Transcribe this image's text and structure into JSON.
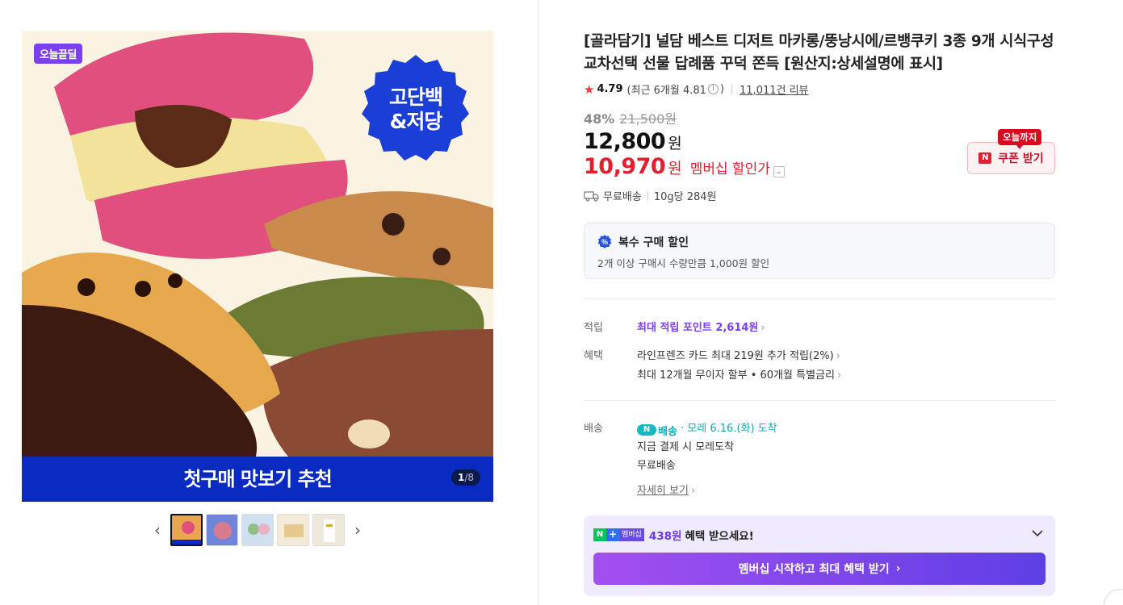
{
  "gallery": {
    "badge": "오늘끝딜",
    "seal_line1": "고단백",
    "seal_line2": "&저당",
    "banner": "첫구매 맛보기 추천",
    "counter_current": "1",
    "counter_total": "/8",
    "thumbnails": 5
  },
  "product": {
    "title": "[골라담기] 널담 베스트 디저트 마카롱/뚱낭시에/르뱅쿠키 3종 9개 시식구성 교차선택 선물 답례품 꾸덕 쫀득 [원산지:상세설명에 표시]",
    "rating": "4.79",
    "recent_rating": "(최근 6개월 4.81",
    "recent_close": ")",
    "reviews": "11,011건 리뷰",
    "discount_pct": "48%",
    "original_price": "21,500원",
    "price": "12,800",
    "won": "원",
    "member_price": "10,970",
    "member_label": "멤버십 할인가",
    "coupon_tag": "오늘까지",
    "coupon_label": "쿠폰 받기",
    "shipping": "무료배송",
    "unit_price": "10g당 284원"
  },
  "multi_discount": {
    "title": "복수 구매 할인",
    "desc": "2개 이상 구매시 수량만큼 1,000원 할인"
  },
  "benefits": {
    "points_label": "적립",
    "points_prefix": "최대 적립 포인트 ",
    "points_value": "2,614원",
    "benefit_label": "혜택",
    "benefit_1": "라인프렌즈 카드 최대 219원 추가 적립(2%)",
    "benefit_2": "최대 12개월 무이자 할부 • 60개월 특별금리"
  },
  "delivery": {
    "label": "배송",
    "npay_label": "배송",
    "arrival": "· 모레 6.16.(화) 도착",
    "line1": "지금 결제 시 모레도착",
    "line2": "무료배송",
    "details": "자세히 보기"
  },
  "membership": {
    "badge_word": "멤버십",
    "amount": "438원",
    "suffix": "혜택 받으세요!",
    "cta": "멤버십 시작하고 최대 혜택 받기"
  },
  "colors": {
    "accent_red": "#e0202f",
    "accent_purple": "#7b3ff2",
    "banner_blue": "#0a2bc2",
    "teal": "#16a7b0"
  }
}
